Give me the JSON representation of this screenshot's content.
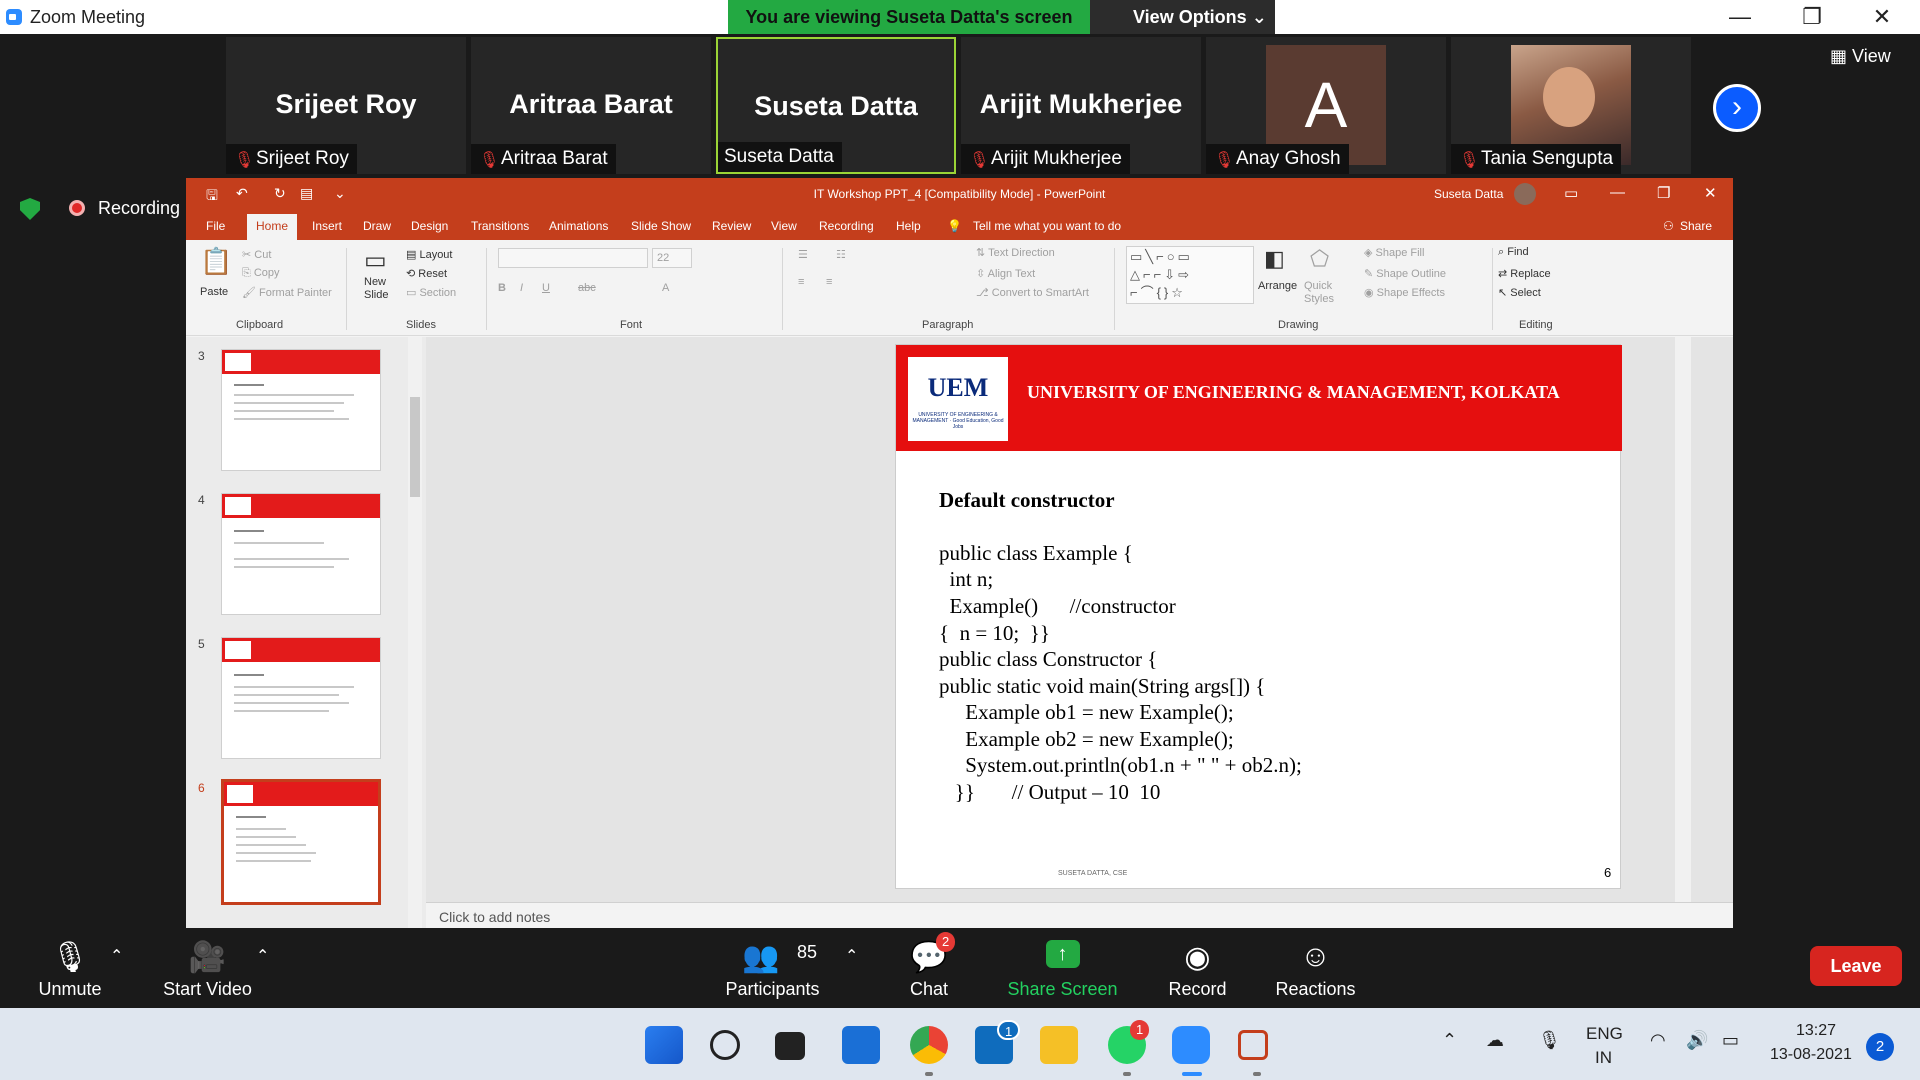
{
  "zoom": {
    "window_title": "Zoom Meeting",
    "viewing_banner": "You are viewing Suseta Datta's screen",
    "view_options": "View Options",
    "view_button": "View",
    "recording_label": "Recording",
    "participants": [
      {
        "display": "Srijeet Roy",
        "caption": "Srijeet Roy",
        "muted": true,
        "avatar": "name"
      },
      {
        "display": "Aritraa Barat",
        "caption": "Aritraa Barat",
        "muted": true,
        "avatar": "name"
      },
      {
        "display": "Suseta Datta",
        "caption": "Suseta Datta",
        "muted": false,
        "avatar": "name",
        "active": true
      },
      {
        "display": "Arijit Mukherjee",
        "caption": "Arijit Mukherjee",
        "muted": true,
        "avatar": "name"
      },
      {
        "display": "A",
        "caption": "Anay Ghosh",
        "muted": true,
        "avatar": "letter"
      },
      {
        "display": "",
        "caption": "Tania Sengupta",
        "muted": true,
        "avatar": "photo"
      }
    ],
    "controls": {
      "unmute": "Unmute",
      "start_video": "Start Video",
      "participants": "Participants",
      "participants_count": "85",
      "chat": "Chat",
      "chat_badge": "2",
      "share_screen": "Share Screen",
      "record": "Record",
      "reactions": "Reactions",
      "leave": "Leave"
    }
  },
  "ppt": {
    "title": "IT Workshop PPT_4 [Compatibility Mode]  -  PowerPoint",
    "user": "Suseta Datta",
    "tabs": [
      "File",
      "Home",
      "Insert",
      "Draw",
      "Design",
      "Transitions",
      "Animations",
      "Slide Show",
      "Review",
      "View",
      "Recording",
      "Help"
    ],
    "tell_me": "Tell me what you want to do",
    "share": "Share",
    "ribbon": {
      "paste": "Paste",
      "cut": "Cut",
      "copy": "Copy",
      "format_painter": "Format Painter",
      "clipboard": "Clipboard",
      "new_slide": "New Slide",
      "layout": "Layout",
      "reset": "Reset",
      "section": "Section",
      "slides": "Slides",
      "font_size": "22",
      "font": "Font",
      "text_direction": "Text Direction",
      "align_text": "Align Text",
      "convert_smartart": "Convert to SmartArt",
      "paragraph": "Paragraph",
      "arrange": "Arrange",
      "quick_styles": "Quick Styles",
      "shape_fill": "Shape Fill",
      "shape_outline": "Shape Outline",
      "shape_effects": "Shape Effects",
      "drawing": "Drawing",
      "find": "Find",
      "replace": "Replace",
      "select": "Select",
      "editing": "Editing"
    },
    "slide_numbers": [
      "3",
      "4",
      "5",
      "6"
    ],
    "slide": {
      "logo_text": "UEM",
      "logo_sub": "UNIVERSITY OF ENGINEERING & MANAGEMENT · Good Education, Good Jobs",
      "header": "UNIVERSITY OF ENGINEERING & MANAGEMENT, KOLKATA",
      "heading": "Default constructor",
      "code": [
        "public class Example {",
        "  int n;",
        "  Example()      //constructor",
        "{  n = 10;  }}",
        "public class Constructor {",
        "public static void main(String args[]) {",
        "     Example ob1 = new Example();",
        "     Example ob2 = new Example();",
        "     System.out.println(ob1.n + \" \" + ob2.n);",
        "   }}       // Output – 10  10"
      ],
      "footer": "SUSETA DATTA, CSE",
      "page": "6"
    },
    "notes": "Click to add notes"
  },
  "taskbar": {
    "lang_line1": "ENG",
    "lang_line2": "IN",
    "time": "13:27",
    "date": "13-08-2021",
    "notifications": "2",
    "mail_badge": "1",
    "whatsapp_badge": "1"
  }
}
